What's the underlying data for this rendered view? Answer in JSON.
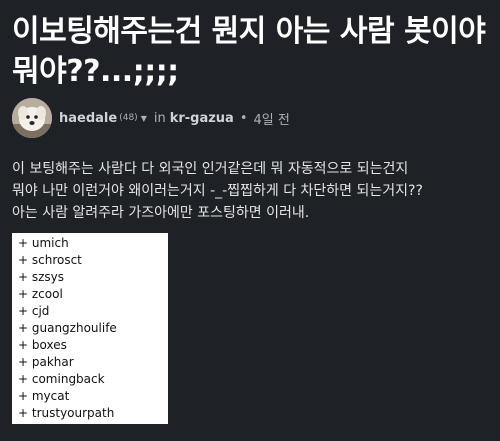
{
  "post": {
    "title": "이보팅해주는건 뭔지 아는 사람 봇이야 뭐야??...;;;;",
    "author": "haedale",
    "reputation": "(48)",
    "in_label": "in",
    "community": "kr-gazua",
    "separator": "•",
    "time_ago": "4일 전",
    "body_lines": [
      "이 보팅해주는 사람다 다 외국인 인거같은데 뭐 자동적으로 되는건지",
      "뭐야 나만 이런거야 왜이러는거지 -_-찝찝하게 다 차단하면 되는거지??",
      "아는 사람 알려주라 가즈아에만 포스팅하면 이러내."
    ],
    "voters": [
      "+ umich",
      "+ schrosct",
      "+ szsys",
      "+ zcool",
      "+ cjd",
      "+ guangzhoulife",
      "+ boxes",
      "+ pakhar",
      "+ comingback",
      "+ mycat",
      "+ trustyourpath"
    ]
  },
  "icons": {
    "avatar": "dog-avatar",
    "author_menu": "chevron-down-icon"
  },
  "colors": {
    "background": "#1e2227",
    "title": "#ffffff",
    "text": "#e4e4e4",
    "muted": "#aab0b6",
    "tag_box_bg": "#ffffff"
  }
}
